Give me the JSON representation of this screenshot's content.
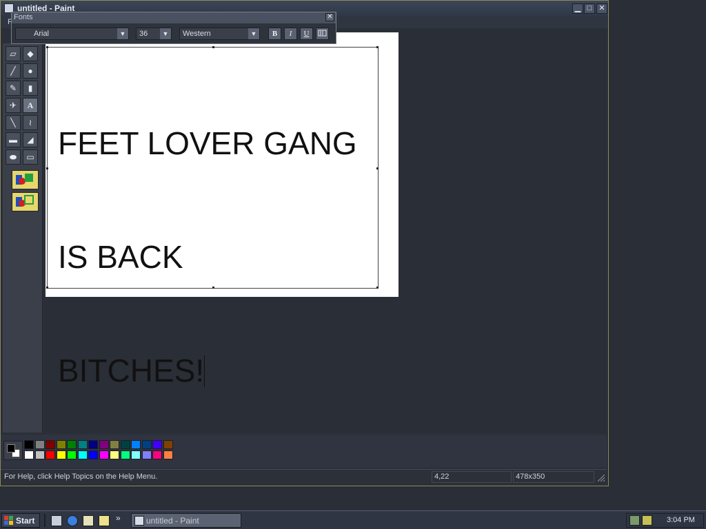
{
  "window": {
    "title": "untitled - Paint",
    "menu_hint": "F",
    "minimize_glyph": "▁",
    "maximize_glyph": "□",
    "close_glyph": "✕"
  },
  "fonts_toolbar": {
    "title": "Fonts",
    "close_glyph": "✕",
    "font_name": "Arial",
    "font_size": "36",
    "script": "Western",
    "bold_label": "B",
    "italic_label": "I",
    "underline_label": "U"
  },
  "tools": [
    {
      "name": "eraser-tool",
      "icon": "eraser-icon",
      "glyph": "▱"
    },
    {
      "name": "fill-tool",
      "icon": "paint-bucket-icon",
      "glyph": "◆"
    },
    {
      "name": "color-picker-tool",
      "icon": "eyedropper-icon",
      "glyph": "╱"
    },
    {
      "name": "magnifier-tool",
      "icon": "magnifier-icon",
      "glyph": "●"
    },
    {
      "name": "pencil-tool",
      "icon": "pencil-icon",
      "glyph": "✎"
    },
    {
      "name": "brush-tool",
      "icon": "brush-icon",
      "glyph": "▮"
    },
    {
      "name": "airbrush-tool",
      "icon": "airbrush-icon",
      "glyph": "✈"
    },
    {
      "name": "text-tool",
      "icon": "text-a-icon",
      "glyph": "A"
    },
    {
      "name": "line-tool",
      "icon": "line-icon",
      "glyph": "╲"
    },
    {
      "name": "curve-tool",
      "icon": "curve-icon",
      "glyph": "≀"
    },
    {
      "name": "rectangle-tool",
      "icon": "rectangle-icon",
      "glyph": "▬"
    },
    {
      "name": "polygon-tool",
      "icon": "polygon-icon",
      "glyph": "◢"
    },
    {
      "name": "ellipse-tool",
      "icon": "ellipse-icon",
      "glyph": "⬬"
    },
    {
      "name": "rounded-rectangle-tool",
      "icon": "rounded-rectangle-icon",
      "glyph": "▭"
    }
  ],
  "canvas_text": {
    "line1": "FEET LOVER GANG",
    "line2": "IS BACK",
    "line3": "BITCHES!"
  },
  "palette": {
    "foreground": "#000000",
    "background": "#ffffff",
    "row1": [
      "#000000",
      "#808080",
      "#800000",
      "#808000",
      "#008000",
      "#008080",
      "#000080",
      "#800080",
      "#808040",
      "#004040",
      "#0080ff",
      "#004080",
      "#4000ff",
      "#804000"
    ],
    "row2": [
      "#ffffff",
      "#c0c0c0",
      "#ff0000",
      "#ffff00",
      "#00ff00",
      "#00ffff",
      "#0000ff",
      "#ff00ff",
      "#ffff80",
      "#00ff80",
      "#80ffff",
      "#8080ff",
      "#ff0080",
      "#ff8040"
    ]
  },
  "status": {
    "help": "For Help, click Help Topics on the Help Menu.",
    "coords": "4,22",
    "size": "478x350"
  },
  "taskbar": {
    "start_label": "Start",
    "task_label": "untitled - Paint",
    "chevron": "»",
    "clock": "3:04 PM"
  }
}
